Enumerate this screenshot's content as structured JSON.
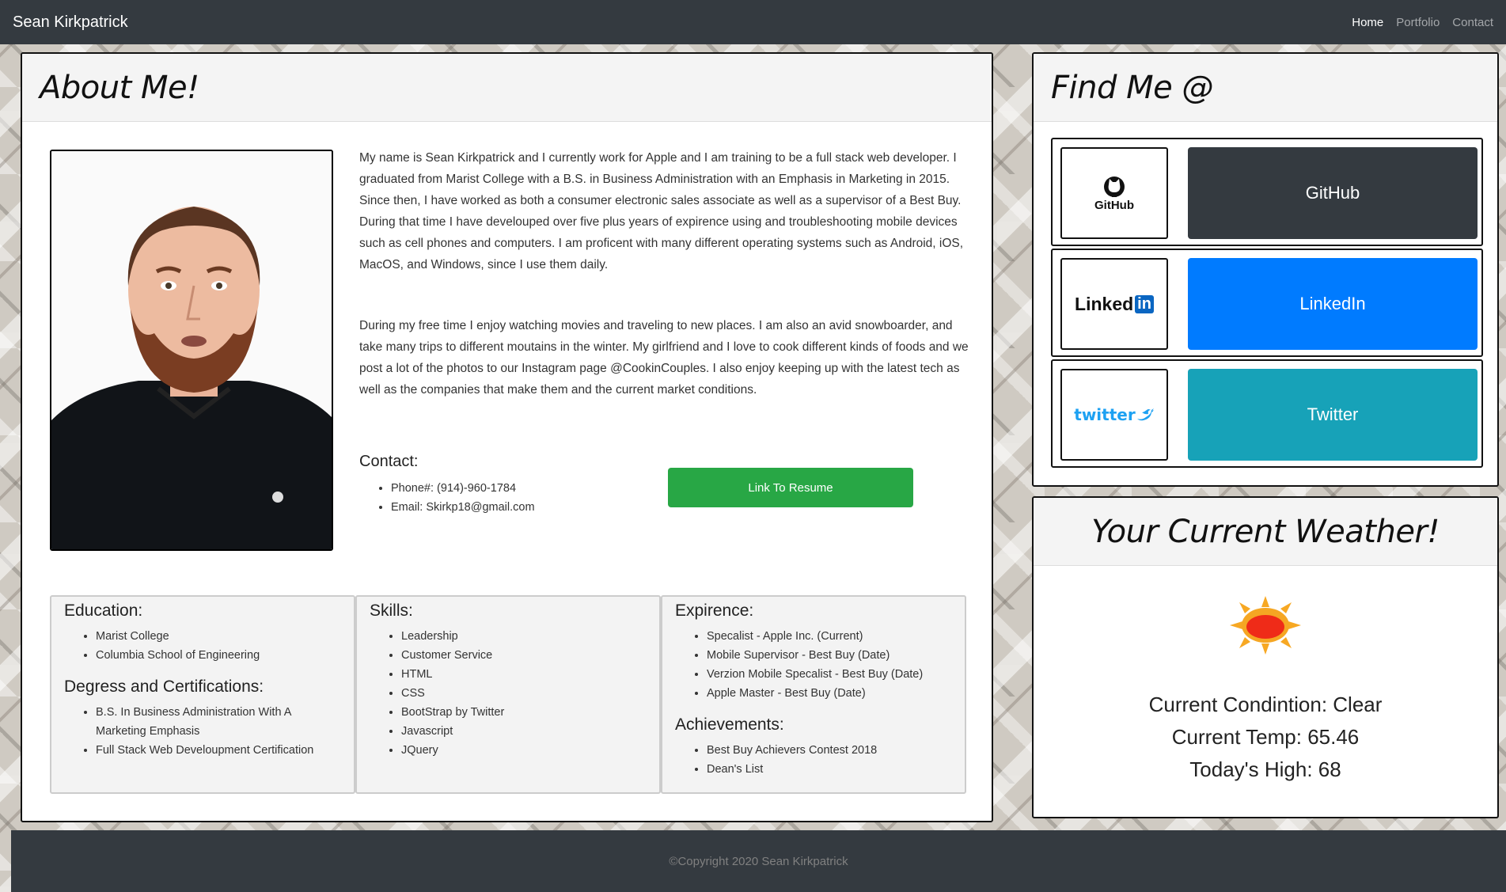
{
  "nav": {
    "brand": "Sean Kirkpatrick",
    "links": [
      "Home",
      "Portfolio",
      "Contact"
    ]
  },
  "about": {
    "title": "About Me!",
    "bio": [
      "My name is Sean Kirkpatrick and I currently work for Apple and I am training to be a full stack web developer. I graduated from Marist College with a B.S. in Business Administration with an Emphasis in Marketing in 2015. Since then, I have worked as both a consumer electronic sales associate as well as a supervisor of a Best Buy. During that time I have develouped over five plus years of expirence using and troubleshooting mobile devices such as cell phones and computers. I am proficent with many different operating systems such as Android, iOS, MacOS, and Windows, since I use them daily.",
      "During my free time I enjoy watching movies and traveling to new places. I am also an avid snowboarder, and take many trips to different moutains in the winter. My girlfriend and I love to cook different kinds of foods and we post a lot of the photos to our Instagram page @CookinCouples. I also enjoy keeping up with the latest tech as well as the companies that make them and the current market conditions."
    ],
    "contact_title": "Contact:",
    "contact": [
      "Phone#: (914)-960-1784",
      "Email: Skirkp18@gmail.com"
    ],
    "resume_label": "Link To Resume"
  },
  "education": {
    "title": "Education:",
    "items": [
      "Marist College",
      "Columbia School of Engineering"
    ],
    "cert_title": "Degress and Certifications:",
    "certs": [
      "B.S. In Business Administration With A Marketing Emphasis",
      "Full Stack Web Develoupment Certification"
    ]
  },
  "skills": {
    "title": "Skills:",
    "items": [
      "Leadership",
      "Customer Service",
      "HTML",
      "CSS",
      "BootStrap by Twitter",
      "Javascript",
      "JQuery"
    ]
  },
  "experience": {
    "title": "Expirence:",
    "items": [
      "Specalist - Apple Inc. (Current)",
      "Mobile Supervisor - Best Buy (Date)",
      "Verzion Mobile Specalist - Best Buy (Date)",
      "Apple Master - Best Buy (Date)"
    ],
    "achievements_title": "Achievements:",
    "achievements": [
      "Best Buy Achievers Contest 2018",
      "Dean's List"
    ]
  },
  "findme": {
    "title": "Find Me @",
    "github_label": "GitHub",
    "github_logo_text": "GitHub",
    "linkedin_label": "LinkedIn",
    "linkedin_logo_text": "Linked",
    "linkedin_logo_in": "in",
    "twitter_label": "Twitter",
    "twitter_logo_text": "twitter",
    "colors": {
      "github": "#343a40",
      "linkedin": "#007bff",
      "twitter": "#17a2b8"
    }
  },
  "weather": {
    "title": "Your Current Weather!",
    "icon": "sun-icon",
    "condition": "Current Condintion: Clear",
    "temp": "Current Temp: 65.46",
    "high": "Today's High: 68"
  },
  "footer": {
    "copyright": "©Copyright 2020 Sean Kirkpatrick"
  }
}
